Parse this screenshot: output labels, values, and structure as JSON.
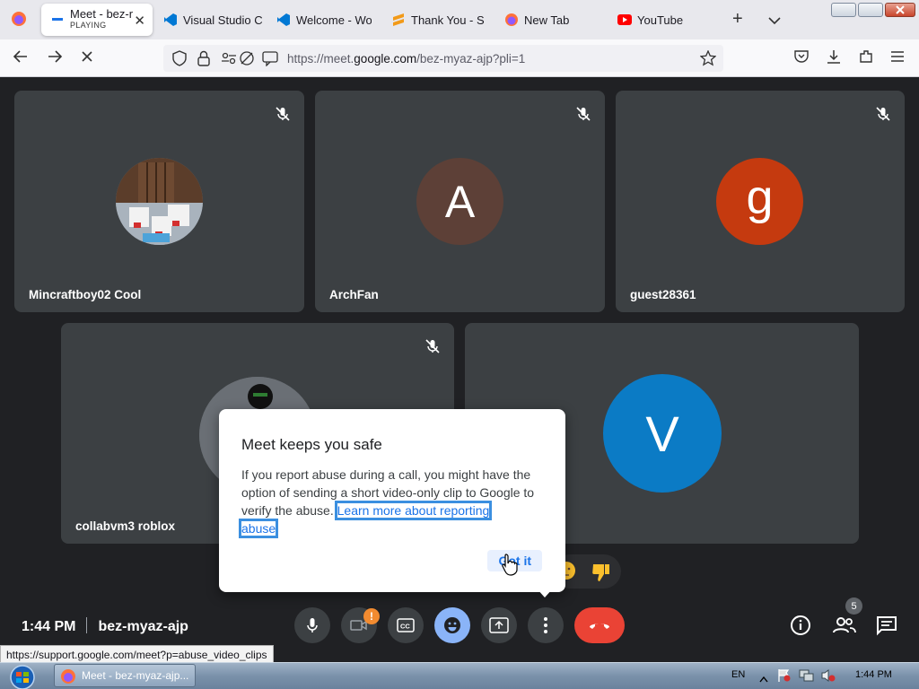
{
  "browser": {
    "tabs": [
      {
        "label": "Meet - bez-r",
        "sublabel": "PLAYING",
        "icon": "meet-icon",
        "active": true
      },
      {
        "label": "Visual Studio Cc",
        "icon": "vscode-icon"
      },
      {
        "label": "Welcome - Wor",
        "icon": "vscode-icon"
      },
      {
        "label": "Thank You - Sul",
        "icon": "sublime-icon"
      },
      {
        "label": "New Tab",
        "icon": "firefox-icon"
      },
      {
        "label": "YouTube",
        "icon": "youtube-icon"
      }
    ],
    "url_prefix": "https://meet.",
    "url_domain": "google.com",
    "url_suffix": "/bez-myaz-ajp?pli=1",
    "status_url": "https://support.google.com/meet?p=abuse_video_clips"
  },
  "participants": [
    {
      "name": "Mincraftboy02 Cool",
      "avatar_type": "image",
      "muted": true
    },
    {
      "name": "ArchFan",
      "initial": "A",
      "color": "#5d4037",
      "muted": true
    },
    {
      "name": "guest28361",
      "initial": "g",
      "color": "#c53a0f",
      "muted": true
    },
    {
      "name": "collabvm3 roblox",
      "avatar_type": "image",
      "muted": true
    },
    {
      "name": "",
      "initial": "V",
      "color": "#0b7bc5",
      "muted": false
    }
  ],
  "dialog": {
    "title": "Meet keeps you safe",
    "body": "If you report abuse during a call, you might have the option of sending a short video-only clip to Google to verify the abuse.",
    "link1": "Learn more about reporting",
    "link2": "abuse",
    "button": "Got it"
  },
  "meeting": {
    "time": "1:44 PM",
    "code": "bez-myaz-ajp",
    "people_count": "5",
    "camera_warning": "!"
  },
  "taskbar": {
    "task_label": "Meet - bez-myaz-ajp...",
    "lang": "EN",
    "clock": "1:44 PM"
  },
  "colors": {
    "meet_bg": "#202124",
    "tile_bg": "#3c4043",
    "end_call": "#ea4335",
    "accent_blue": "#1a73e8"
  }
}
